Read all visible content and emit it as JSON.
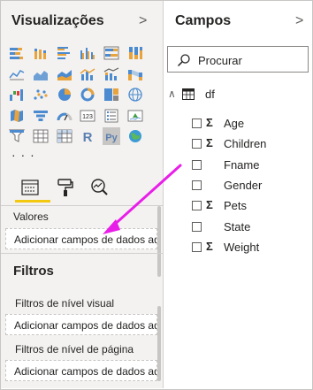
{
  "visualizations": {
    "title": "Visualizações",
    "expand_icon": "chevron-right-icon",
    "gallery": [
      [
        "stacked-bar-chart-icon",
        "stacked-column-chart-icon",
        "clustered-bar-chart-icon",
        "clustered-column-chart-icon",
        "100-stacked-bar-chart-icon",
        "100-stacked-column-chart-icon"
      ],
      [
        "line-chart-icon",
        "area-chart-icon",
        "stacked-area-chart-icon",
        "line-and-column-chart-icon",
        "line-and-stacked-column-chart-icon",
        "ribbon-chart-icon"
      ],
      [
        "waterfall-chart-icon",
        "scatter-chart-icon",
        "pie-chart-icon",
        "donut-chart-icon",
        "treemap-icon",
        "map-icon"
      ],
      [
        "filled-map-icon",
        "funnel-icon",
        "gauge-icon",
        "card-icon",
        "multi-row-card-icon",
        "kpi-icon"
      ],
      [
        "slicer-icon",
        "table-visual-icon",
        "matrix-icon",
        "r-visual-icon",
        "python-visual-icon",
        "arcgis-map-icon"
      ]
    ],
    "more": "· · ·",
    "tabs": [
      {
        "name": "fields-tab",
        "icon": "fields-well-icon",
        "selected": true
      },
      {
        "name": "format-tab",
        "icon": "paint-roller-icon",
        "selected": false
      },
      {
        "name": "analytics-tab",
        "icon": "analytics-magnifier-icon",
        "selected": false
      }
    ],
    "accent": "#f2c811",
    "values_label": "Valores",
    "values_drop": "Adicionar campos de dados aqui",
    "filters_title": "Filtros",
    "visual_filters_label": "Filtros de nível visual",
    "visual_filters_drop": "Adicionar campos de dados aqui",
    "page_filters_label": "Filtros de nível de página",
    "page_filters_drop": "Adicionar campos de dados aqui"
  },
  "fields": {
    "title": "Campos",
    "expand_icon": "chevron-right-icon",
    "search_placeholder": "Procurar",
    "table": {
      "expanded_icon": "chevron-up-icon",
      "name": "df",
      "columns": [
        {
          "name": "Age",
          "numeric": true
        },
        {
          "name": "Children",
          "numeric": true
        },
        {
          "name": "Fname",
          "numeric": false
        },
        {
          "name": "Gender",
          "numeric": false
        },
        {
          "name": "Pets",
          "numeric": true
        },
        {
          "name": "State",
          "numeric": false
        },
        {
          "name": "Weight",
          "numeric": true
        }
      ]
    },
    "sigma_symbol": "Σ"
  },
  "annotation": {
    "arrow_color": "#e81ee8"
  }
}
